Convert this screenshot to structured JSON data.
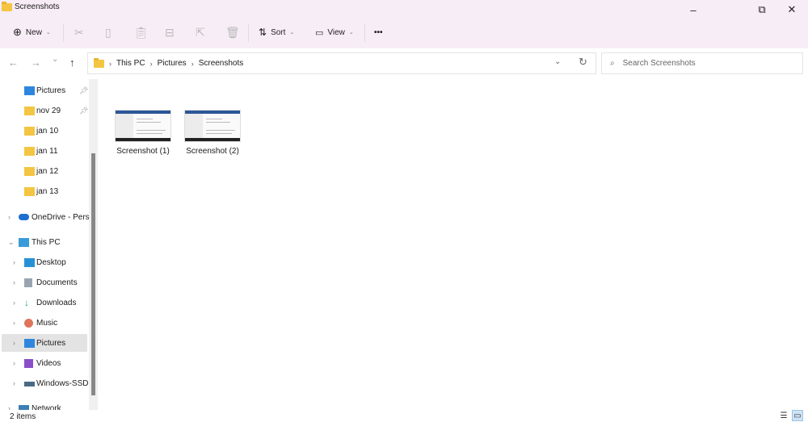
{
  "window": {
    "title": "Screenshots",
    "minimize": "–",
    "maximize": "⧉",
    "close": "✕"
  },
  "toolbar": {
    "new_label": "New",
    "sort_label": "Sort",
    "view_label": "View",
    "more_label": "•••",
    "icons": [
      "cut-icon",
      "copy-icon",
      "paste-icon",
      "rename-icon",
      "share-icon",
      "delete-icon"
    ]
  },
  "nav": {
    "back": "←",
    "forward": "→",
    "recent": "⌄",
    "up": "↑",
    "breadcrumb": [
      "This PC",
      "Pictures",
      "Screenshots"
    ],
    "search_placeholder": "Search Screenshots"
  },
  "sidebar": {
    "quick_access": [
      {
        "label": "Pictures",
        "icon": "pictures",
        "pinned": true
      },
      {
        "label": "nov 29",
        "icon": "folder",
        "pinned": true
      },
      {
        "label": "jan 10",
        "icon": "folder"
      },
      {
        "label": "jan 11",
        "icon": "folder"
      },
      {
        "label": "jan 12",
        "icon": "folder"
      },
      {
        "label": "jan 13",
        "icon": "folder"
      }
    ],
    "onedrive": "OneDrive - Perso",
    "this_pc": "This PC",
    "pc_items": [
      {
        "label": "Desktop",
        "icon": "desktop"
      },
      {
        "label": "Documents",
        "icon": "documents"
      },
      {
        "label": "Downloads",
        "icon": "downloads"
      },
      {
        "label": "Music",
        "icon": "music"
      },
      {
        "label": "Pictures",
        "icon": "pictures",
        "selected": true
      },
      {
        "label": "Videos",
        "icon": "videos"
      },
      {
        "label": "Windows-SSD (",
        "icon": "drive"
      }
    ],
    "network": "Network"
  },
  "files": [
    {
      "name": "Screenshot (1)"
    },
    {
      "name": "Screenshot (2)"
    }
  ],
  "status": {
    "count": "2 items"
  },
  "colors": {
    "titlebar": "#f7edf6",
    "selected": "#e3e3e3",
    "folder": "#f4c542",
    "accent": "#2b5797"
  }
}
